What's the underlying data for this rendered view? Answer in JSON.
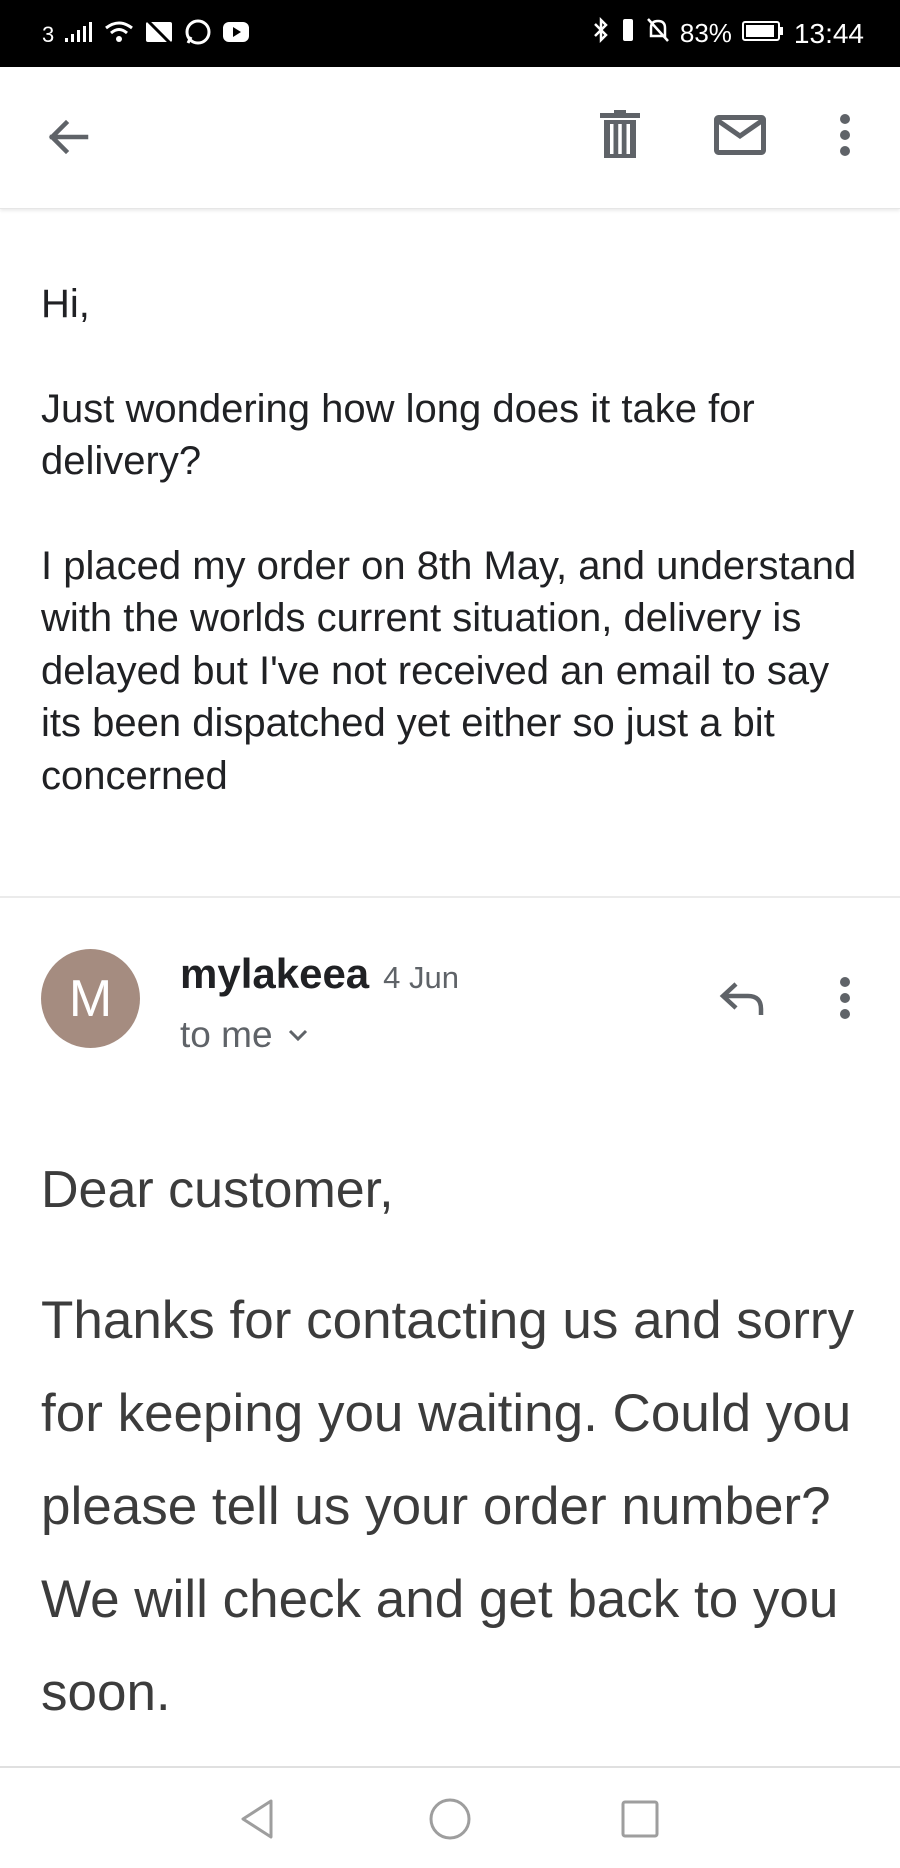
{
  "status_bar": {
    "carrier": "3",
    "battery": "83%",
    "time": "13:44",
    "left_icons": [
      "signal-icon",
      "wifi-icon",
      "no-image-icon",
      "whatsapp-icon",
      "youtube-icon"
    ],
    "right_icons": [
      "bluetooth-icon",
      "vibrate-icon",
      "alarm-off-icon",
      "battery-icon"
    ]
  },
  "app_bar": {
    "back_icon": "arrow-left-icon",
    "actions": [
      "delete-icon",
      "mail-icon",
      "more-vert-icon"
    ]
  },
  "first_message": {
    "paragraphs": [
      "Hi,",
      "Just wondering how long does it take for delivery?",
      "I placed my order on 8th May, and understand with the worlds current situation, delivery is delayed but I've not received an email to say its been dispatched yet either so just a bit concerned"
    ]
  },
  "reply": {
    "avatar_letter": "M",
    "avatar_color": "#a58c80",
    "sender": "mylakeea",
    "date": "4 Jun",
    "recipient": "to me",
    "salutation": "Dear customer,",
    "body": "Thanks for contacting us and sorry for keeping you waiting. Could you please tell us your order number? We will check and get back to you soon."
  },
  "nav_bar": {
    "buttons": [
      "back-triangle-icon",
      "home-circle-icon",
      "recents-square-icon"
    ]
  }
}
